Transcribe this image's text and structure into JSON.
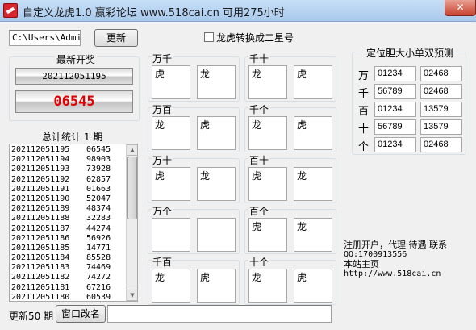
{
  "window": {
    "title": "自定义龙虎1.0    赢彩论坛 www.518cai.cn  可用275小时",
    "close_glyph": "✕"
  },
  "toolbar": {
    "path_value": "C:\\Users\\Admin",
    "update_label": "更新",
    "checkbox_label": "龙虎转换成二星号"
  },
  "latest": {
    "heading": "最新开奖",
    "issue": "202112051195",
    "number": "06545"
  },
  "stats": {
    "heading": "总计统计 1 期"
  },
  "history": [
    [
      "202112051195",
      "06545"
    ],
    [
      "202112051194",
      "98903"
    ],
    [
      "202112051193",
      "73928"
    ],
    [
      "202112051192",
      "02857"
    ],
    [
      "202112051191",
      "01663"
    ],
    [
      "202112051190",
      "52047"
    ],
    [
      "202112051189",
      "48374"
    ],
    [
      "202112051188",
      "32283"
    ],
    [
      "202112051187",
      "44274"
    ],
    [
      "202112051186",
      "56926"
    ],
    [
      "202112051185",
      "14771"
    ],
    [
      "202112051184",
      "85528"
    ],
    [
      "202112051183",
      "74469"
    ],
    [
      "202112051182",
      "74272"
    ],
    [
      "202112051181",
      "67216"
    ],
    [
      "202112051180",
      "60539"
    ]
  ],
  "bottom": {
    "update_count_label": "更新50 期",
    "rename_label": "窗口改名",
    "status_value": ""
  },
  "pairs": [
    {
      "name": "万千",
      "left": "虎",
      "right": "龙"
    },
    {
      "name": "千十",
      "left": "龙",
      "right": "虎"
    },
    {
      "name": "万百",
      "left": "龙",
      "right": "虎"
    },
    {
      "name": "千个",
      "left": "龙",
      "right": "虎"
    },
    {
      "name": "万十",
      "left": "虎",
      "right": "龙"
    },
    {
      "name": "百十",
      "left": "虎",
      "right": "龙"
    },
    {
      "name": "万个",
      "left": "",
      "right": ""
    },
    {
      "name": "百个",
      "left": "虎",
      "right": "龙"
    },
    {
      "name": "千百",
      "left": "龙",
      "right": "虎"
    },
    {
      "name": "十个",
      "left": "龙",
      "right": "虎"
    }
  ],
  "prediction": {
    "heading": "定位胆大小单双预测",
    "rows": [
      {
        "pos": "万",
        "a": "01234",
        "b": "02468"
      },
      {
        "pos": "千",
        "a": "56789",
        "b": "02468"
      },
      {
        "pos": "百",
        "a": "01234",
        "b": "13579"
      },
      {
        "pos": "十",
        "a": "56789",
        "b": "13579"
      },
      {
        "pos": "个",
        "a": "01234",
        "b": "02468"
      }
    ]
  },
  "info": {
    "line1": "注册开户，代理 待遇 联系",
    "line2": "QQ:1700913556",
    "line3": "本站主页",
    "line4": "http://www.518cai.cn"
  }
}
